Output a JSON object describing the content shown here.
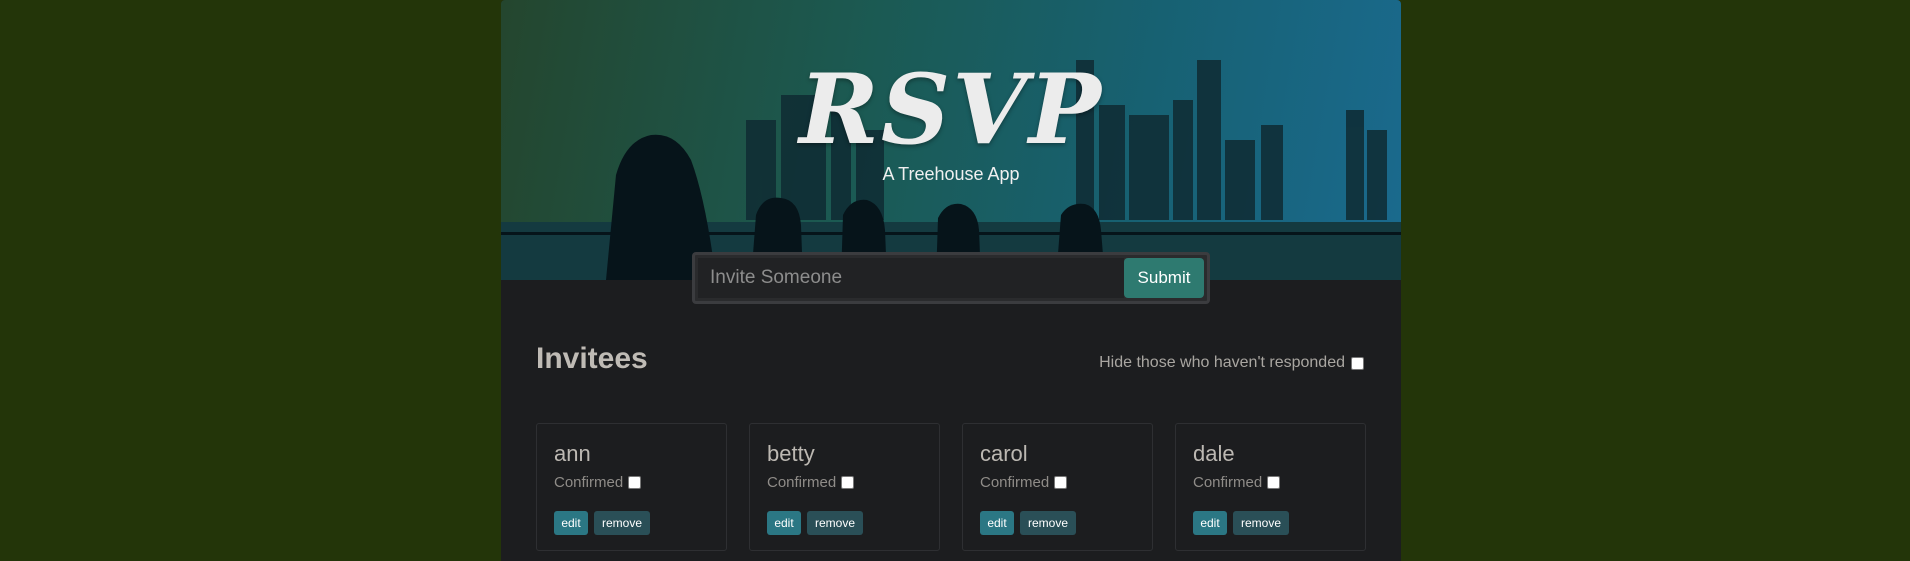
{
  "header": {
    "title": "RSVP",
    "subtitle": "A Treehouse App"
  },
  "form": {
    "placeholder": "Invite Someone",
    "value": "",
    "submit_label": "Submit"
  },
  "main": {
    "heading": "Invitees",
    "filter_label": "Hide those who haven't responded",
    "filter_checked": false
  },
  "invitees": [
    {
      "name": "ann",
      "confirmed_label": "Confirmed",
      "confirmed": false,
      "edit_label": "edit",
      "remove_label": "remove"
    },
    {
      "name": "betty",
      "confirmed_label": "Confirmed",
      "confirmed": false,
      "edit_label": "edit",
      "remove_label": "remove"
    },
    {
      "name": "carol",
      "confirmed_label": "Confirmed",
      "confirmed": false,
      "edit_label": "edit",
      "remove_label": "remove"
    },
    {
      "name": "dale",
      "confirmed_label": "Confirmed",
      "confirmed": false,
      "edit_label": "edit",
      "remove_label": "remove"
    }
  ],
  "colors": {
    "page_background": "#233509",
    "panel_background": "#1c1d1f",
    "submit_button": "#2e7a70",
    "edit_button": "#2b7784",
    "remove_button": "#2a4f57"
  }
}
